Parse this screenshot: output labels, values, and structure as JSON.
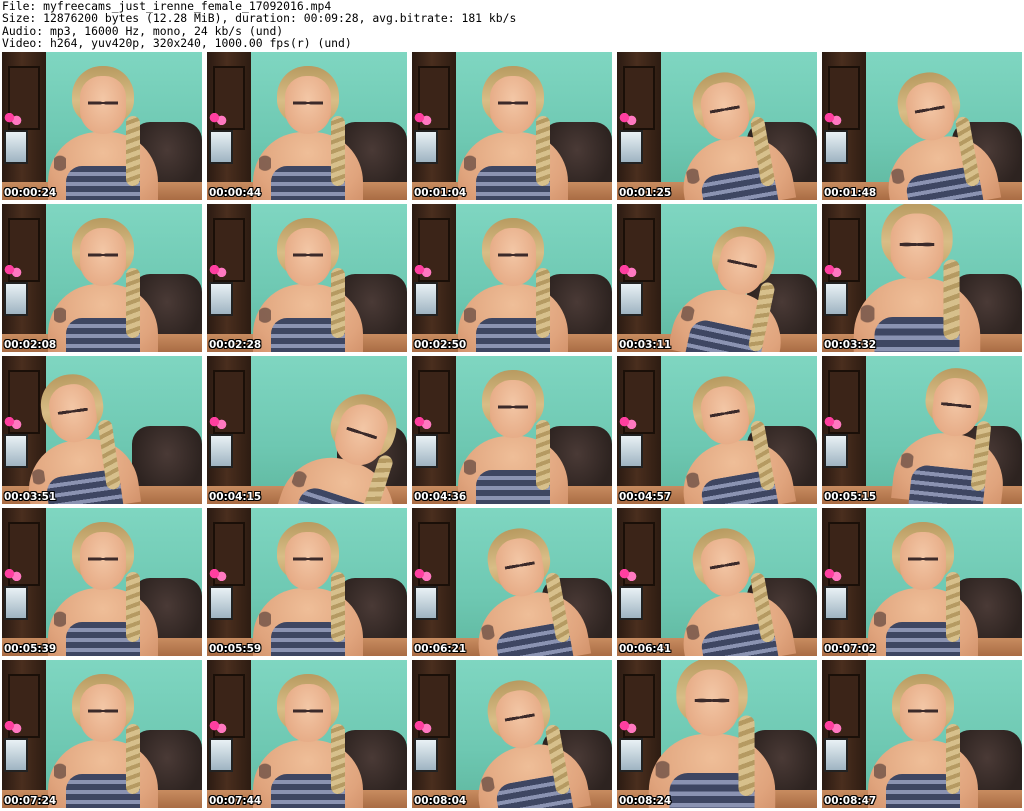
{
  "header": {
    "file_line": "File: myfreecams_just_irenne_female_17092016.mp4",
    "size_line": "Size: 12876200 bytes (12.28 MiB), duration: 00:09:28, avg.bitrate: 181 kb/s",
    "audio_line": "Audio: mp3, 16000 Hz, mono, 24 kb/s (und)",
    "video_line": "Video: h264, yuv420p, 320x240, 1000.00 fps(r) (und)"
  },
  "thumbnails": [
    {
      "time": "00:00:24",
      "variant": "v-center"
    },
    {
      "time": "00:00:44",
      "variant": "v-center"
    },
    {
      "time": "00:01:04",
      "variant": "v-center"
    },
    {
      "time": "00:01:25",
      "variant": "v-lean"
    },
    {
      "time": "00:01:48",
      "variant": "v-lean"
    },
    {
      "time": "00:02:08",
      "variant": "v-center"
    },
    {
      "time": "00:02:28",
      "variant": "v-center"
    },
    {
      "time": "00:02:50",
      "variant": "v-center"
    },
    {
      "time": "00:03:11",
      "variant": "v-side"
    },
    {
      "time": "00:03:32",
      "variant": "v-close"
    },
    {
      "time": "00:03:51",
      "variant": "v-left"
    },
    {
      "time": "00:04:15",
      "variant": "v-away"
    },
    {
      "time": "00:04:36",
      "variant": "v-center"
    },
    {
      "time": "00:04:57",
      "variant": "v-lean"
    },
    {
      "time": "00:05:15",
      "variant": "v-right"
    },
    {
      "time": "00:05:39",
      "variant": "v-center"
    },
    {
      "time": "00:05:59",
      "variant": "v-center"
    },
    {
      "time": "00:06:21",
      "variant": "v-lean"
    },
    {
      "time": "00:06:41",
      "variant": "v-lean"
    },
    {
      "time": "00:07:02",
      "variant": "v-center"
    },
    {
      "time": "00:07:24",
      "variant": "v-center"
    },
    {
      "time": "00:07:44",
      "variant": "v-center"
    },
    {
      "time": "00:08:04",
      "variant": "v-lean"
    },
    {
      "time": "00:08:24",
      "variant": "v-close"
    },
    {
      "time": "00:08:47",
      "variant": "v-center"
    }
  ]
}
